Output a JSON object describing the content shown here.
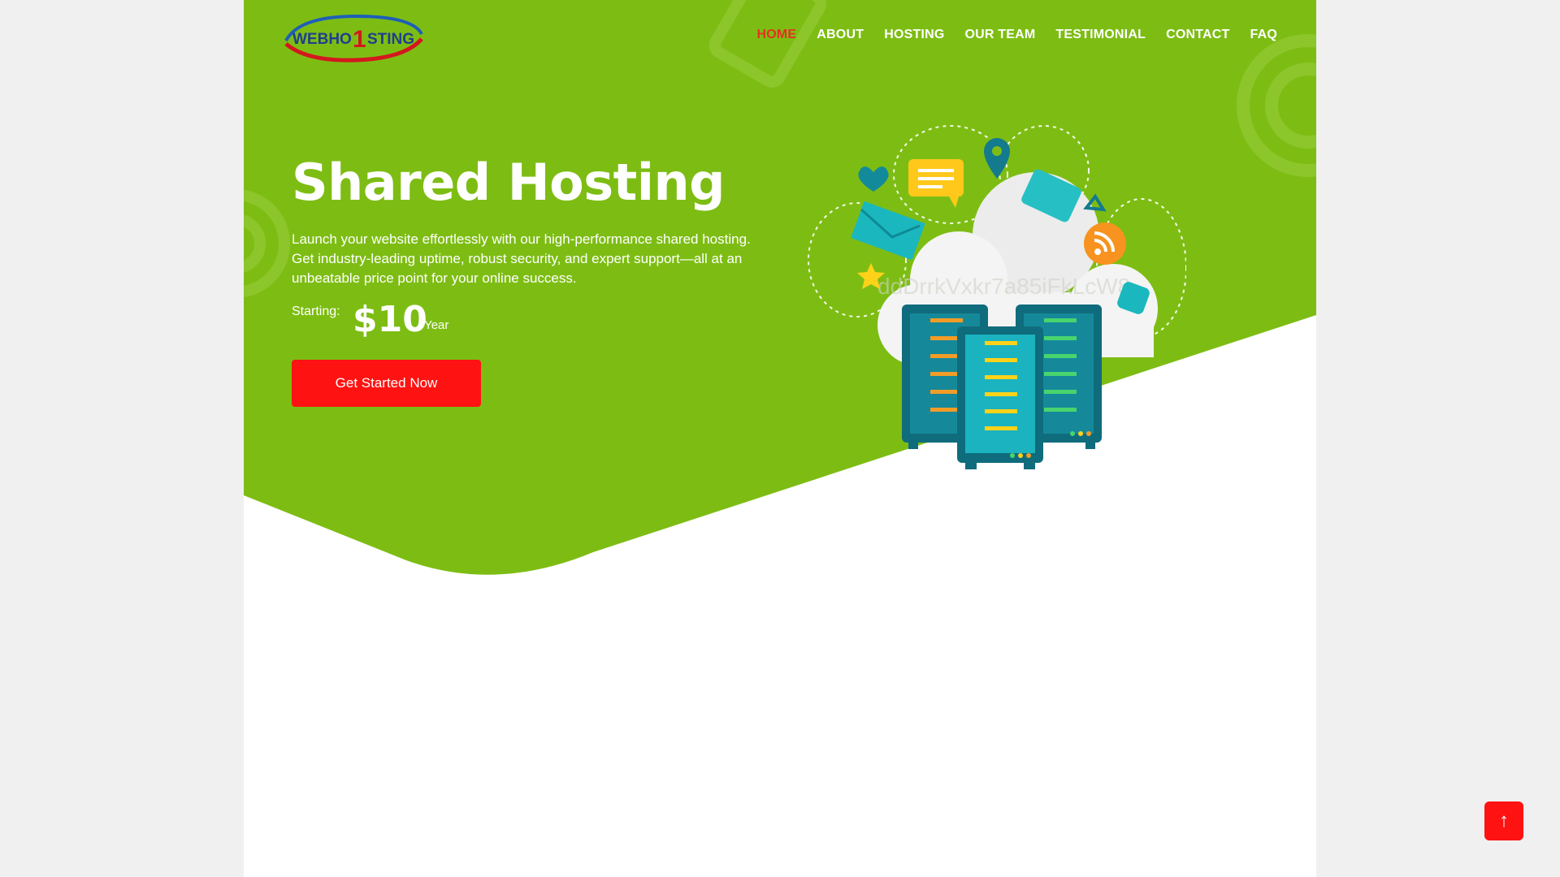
{
  "brand": {
    "logo_text_pre": "WEBHO",
    "logo_text_num": "1",
    "logo_text_post": "STING"
  },
  "nav": {
    "items": [
      {
        "label": "HOME",
        "active": true
      },
      {
        "label": "ABOUT"
      },
      {
        "label": "HOSTING"
      },
      {
        "label": "OUR TEAM"
      },
      {
        "label": "TESTIMONIAL"
      },
      {
        "label": "CONTACT"
      },
      {
        "label": "FAQ"
      }
    ]
  },
  "hero": {
    "title": "Shared Hosting",
    "description": "Launch your website effortlessly with our high-performance shared hosting. Get industry-leading uptime, robust security, and expert support—all at an unbeatable price point for your online success.",
    "price_label": "Starting:",
    "price_value": "$10",
    "price_unit": "/ Year",
    "cta_label": "Get Started Now",
    "watermark": "ddDrrkVxkr7a85iFkLcW8"
  },
  "scroll_top": {
    "label": "↑"
  },
  "colors": {
    "hero_green": "#7dbd13",
    "accent_red": "#ff1212",
    "nav_active": "#e53121",
    "page_bg": "#f0f0f0"
  }
}
